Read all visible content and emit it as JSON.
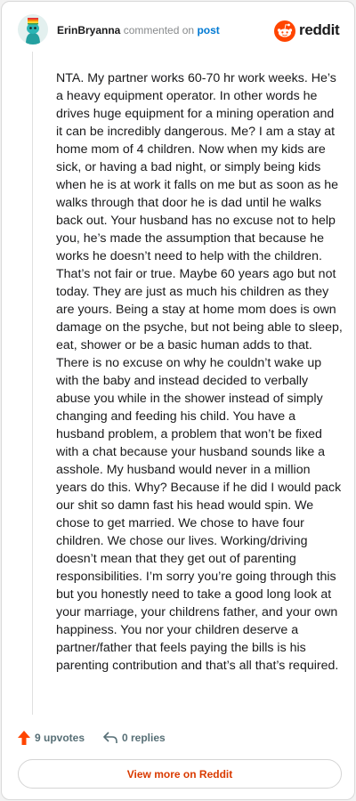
{
  "comment": {
    "author": "ErinBryanna",
    "action": "commented on",
    "target": "post",
    "body": "NTA. My partner works 60-70 hr work weeks. He’s a heavy equipment operator. In other words he drives huge equipment for a mining operation and it can be incredibly dangerous. Me? I am a stay at home mom of 4 children. Now when my kids are sick, or having a bad night, or simply being kids when he is at work it falls on me but as soon as he walks through that door he is dad until he walks back out. Your husband has no excuse not to help you, he’s made the assumption that because he works he doesn’t need to help with the children. That’s not fair or true. Maybe 60 years ago but not today. They are just as much his children as they are yours. Being a stay at home mom does is own damage on the psyche, but not being able to sleep, eat, shower or be a basic human adds to that. There is no excuse on why he couldn’t wake up with the baby and instead decided to verbally abuse you while in the shower instead of simply changing and feeding his child. You have a husband problem, a problem that won’t be fixed with a chat because your husband sounds like a asshole. My husband would never in a million years do this. Why? Because if he did I would pack our shit so damn fast his head would spin. We chose to get married. We chose to have four children. We chose our lives. Working/driving doesn’t mean that they get out of parenting responsibilities. I’m sorry you’re going through this but you honestly need to take a good long look at your marriage, your childrens father, and your own happiness. You nor your children deserve a partner/father that feels paying the bills is his parenting contribution and that’s all that’s required.",
    "upvotes": "9 upvotes",
    "replies": "0 replies"
  },
  "brand": {
    "name": "reddit",
    "color": "#ff4500"
  },
  "footer": {
    "view_more": "View more on Reddit"
  },
  "icons": {
    "avatar": "snoo-avatar-icon",
    "logo": "reddit-logo-icon",
    "upvote": "upvote-arrow-icon",
    "reply": "reply-arrow-icon"
  }
}
